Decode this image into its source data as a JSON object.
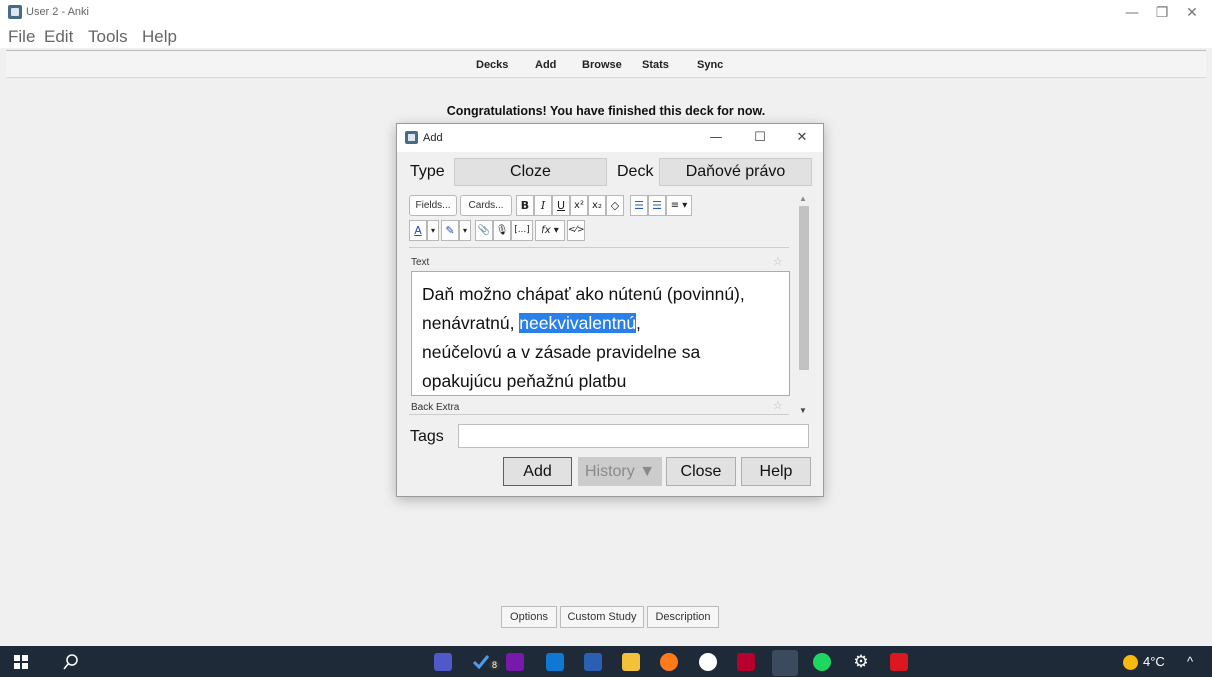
{
  "window": {
    "title": "User 2 - Anki",
    "minimize": "—",
    "maximize": "❐",
    "close": "✕"
  },
  "menu": {
    "file": "File",
    "edit": "Edit",
    "tools": "Tools",
    "help": "Help"
  },
  "toolbar": {
    "decks": "Decks",
    "add": "Add",
    "browse": "Browse",
    "stats": "Stats",
    "sync": "Sync"
  },
  "congrats": "Congratulations! You have finished this deck for now.",
  "dialog": {
    "title": "Add",
    "minimize": "—",
    "maximize": "☐",
    "close": "✕",
    "type_label": "Type",
    "type_value": "Cloze",
    "deck_label": "Deck",
    "deck_value": "Daňové právo",
    "editor_buttons": {
      "fields": "Fields...",
      "cards": "Cards...",
      "bold": "B",
      "italic": "I",
      "underline": "U",
      "superscript": "x²",
      "subscript": "x₂",
      "eraser": "◇",
      "bullets": "☰",
      "numbers": "☰",
      "align": "≡ ▾",
      "text_color": "A",
      "dd1": "▾",
      "highlight": "✎",
      "dd2": "▾",
      "attach": "📎",
      "record": "🎙",
      "cloze": "[...]",
      "formula": "fx ▾",
      "html": "<⁄>"
    },
    "fields": [
      {
        "label": "Text"
      },
      {
        "label": "Back Extra"
      }
    ],
    "text_content": {
      "line1": "Daň možno chápať ako nútenú (povinnú),",
      "line2_before": "nenávratnú, ",
      "line2_selected": "neekvivalentnú",
      "line2_after": ",",
      "line3": "neúčelovú a v zásade pravidelne sa",
      "line4": "opakujúcu peňažnú platbu"
    },
    "tags_label": "Tags",
    "tags_value": "",
    "buttons": {
      "add": "Add",
      "history": "History ▼",
      "close": "Close",
      "help": "Help"
    }
  },
  "bottom_buttons": {
    "options": "Options",
    "custom_study": "Custom Study",
    "description": "Description"
  },
  "taskbar": {
    "icons": [
      "windows-start-icon",
      "search-icon",
      "teams-icon",
      "todo-icon",
      "onenote-icon",
      "outlook-icon",
      "word-icon",
      "file-explorer-icon",
      "firefox-icon",
      "chat-icon",
      "mendeley-icon",
      "anki-icon",
      "spotify-icon",
      "settings-icon",
      "acrobat-icon",
      "weather-icon"
    ],
    "badge": "8",
    "temperature": "4°C",
    "chevron": "^"
  },
  "colors": {
    "selection": "#2a80ea",
    "field_border": "#d9a84a",
    "taskbar": "#1f2a38"
  }
}
